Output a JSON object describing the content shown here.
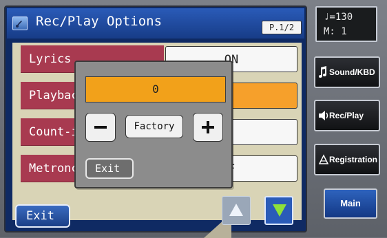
{
  "window": {
    "title": "Rec/Play Options",
    "page": "P.1/2"
  },
  "rows": [
    {
      "label": "Lyrics",
      "value": "ON"
    },
    {
      "label": "Playbac",
      "value": ""
    },
    {
      "label": "Count-i",
      "value": ""
    },
    {
      "label": "Metronc",
      "value": "F"
    }
  ],
  "popup": {
    "value": "0",
    "minus_icon": "minus-icon",
    "factory_label": "Factory",
    "plus_icon": "plus-icon",
    "exit_label": "Exit"
  },
  "footer": {
    "exit_label": "Exit",
    "scroll_up_icon": "triangle-up-icon",
    "scroll_down_icon": "triangle-down-icon"
  },
  "tempo": {
    "line1": "♩=130",
    "line2": "M:   1"
  },
  "side_buttons": [
    {
      "label": "Sound/KBD",
      "icon": "music-note-icon"
    },
    {
      "label": "Rec/Play",
      "icon": "speaker-icon"
    },
    {
      "label": "Registration",
      "icon": "registration-icon"
    }
  ],
  "main_label": "Main",
  "colors": {
    "header_blue": "#2a5bb8",
    "row_label_red": "#a83a50",
    "highlight_orange": "#f6a02b"
  }
}
